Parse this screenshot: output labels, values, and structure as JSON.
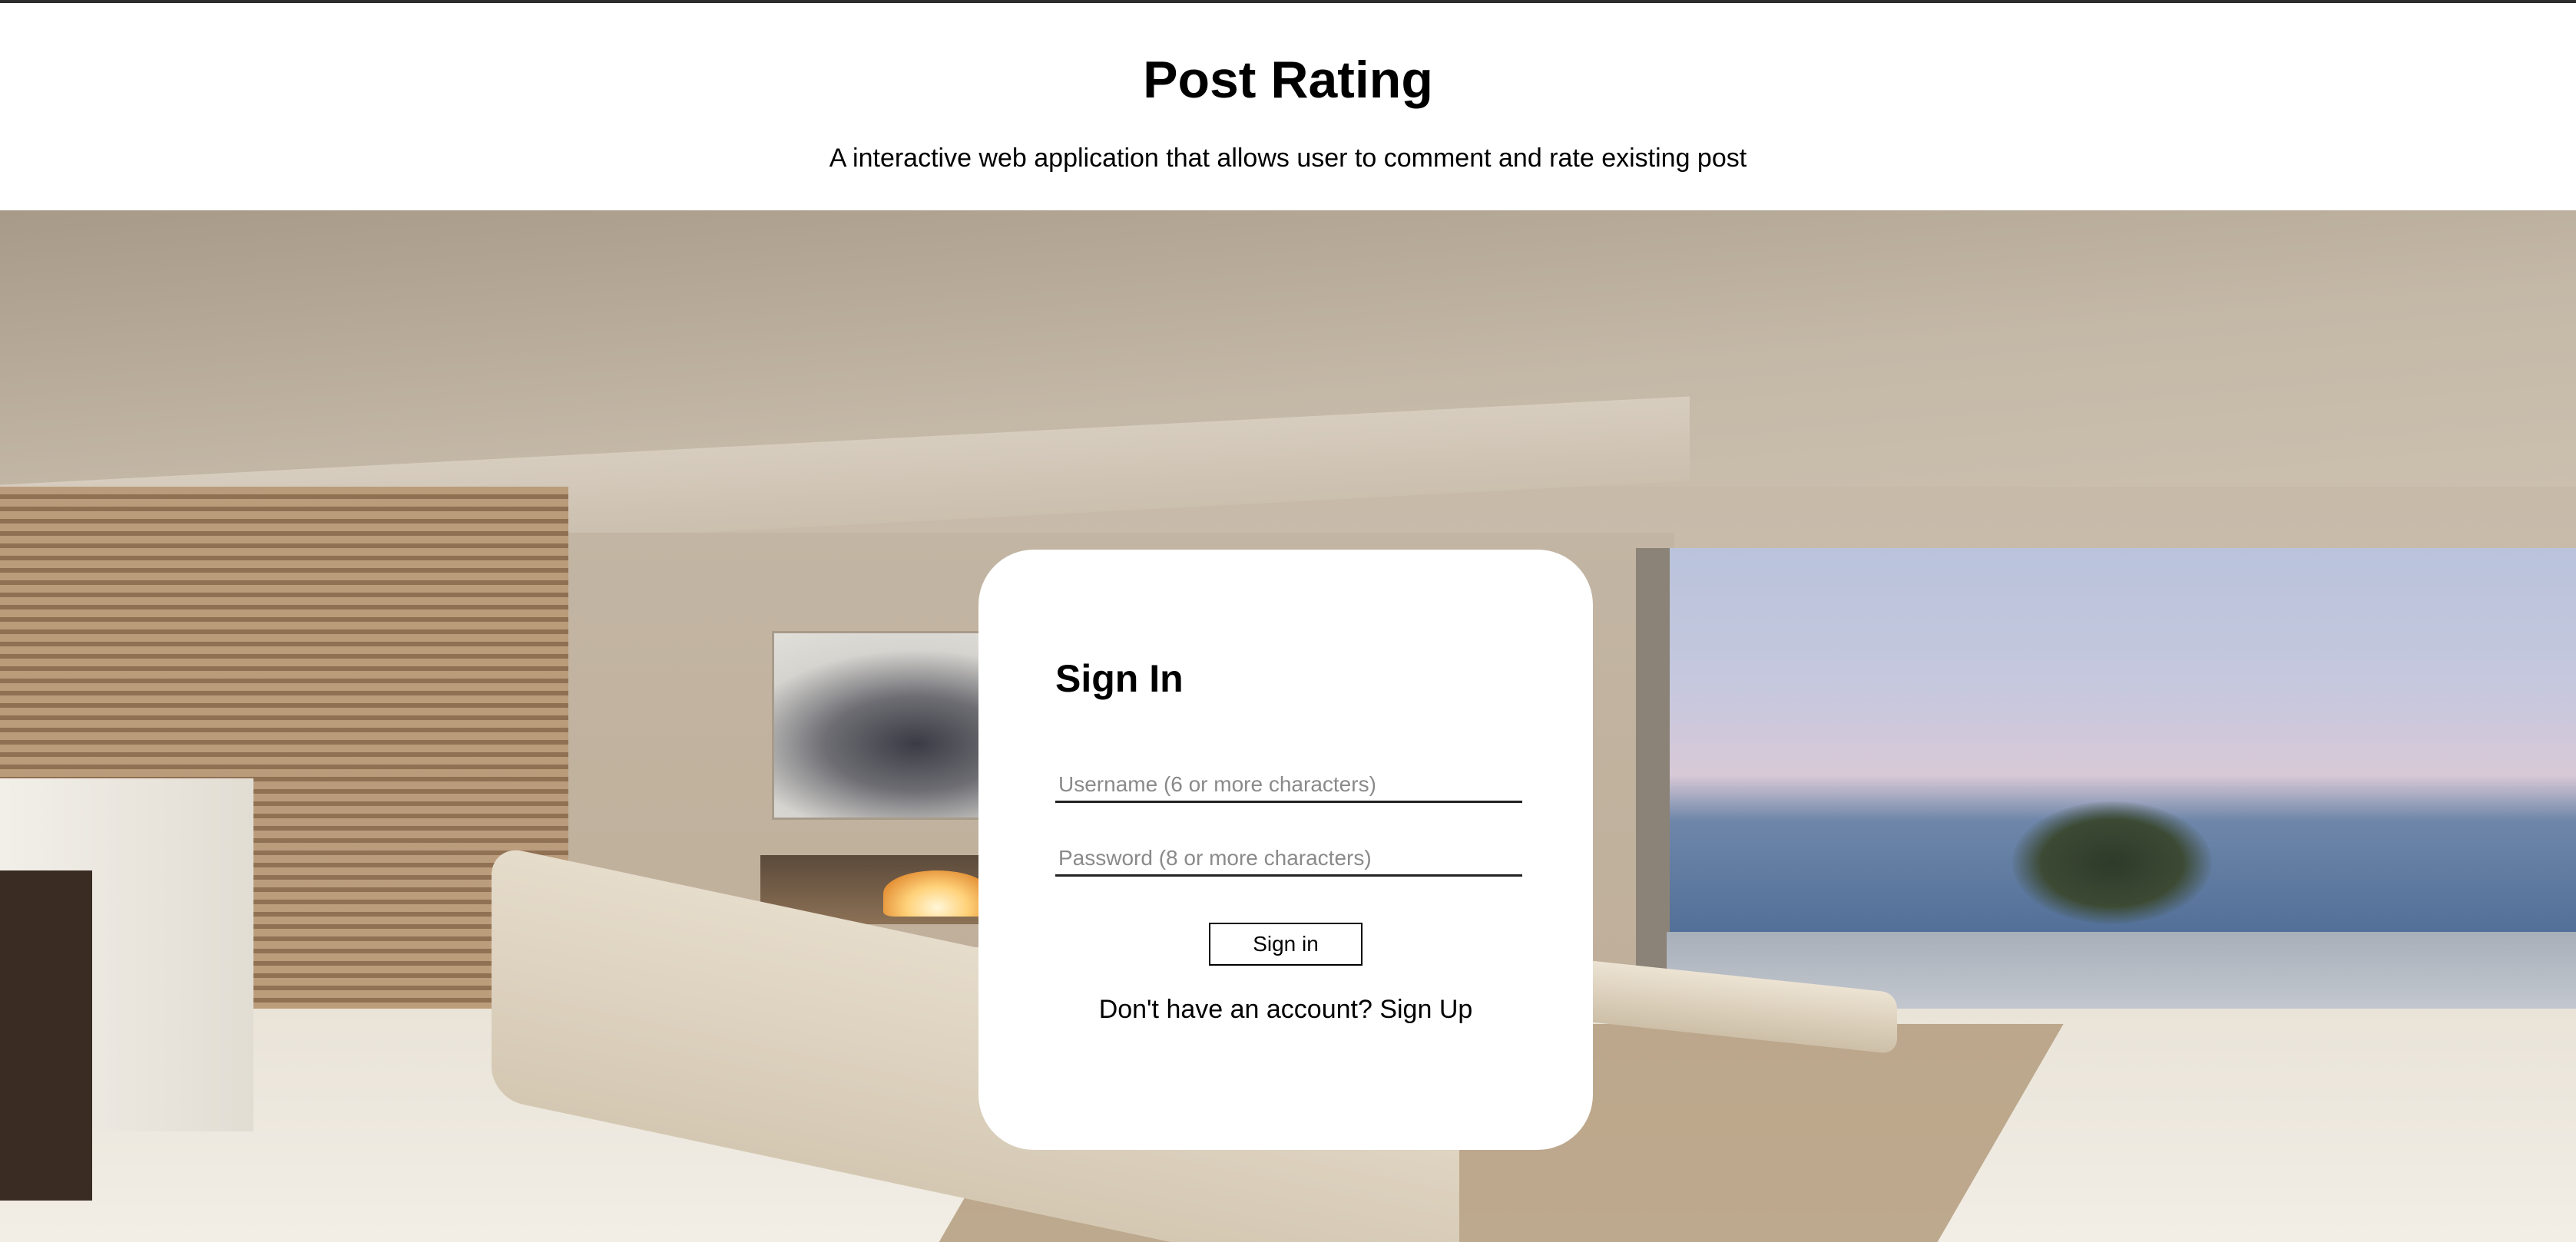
{
  "header": {
    "title": "Post Rating",
    "subtitle": "A interactive web application that allows user to comment and rate existing post"
  },
  "hero": {
    "image": "living-room-ocean-view-photo"
  },
  "signin": {
    "title": "Sign In",
    "username_placeholder": "Username (6 or more characters)",
    "username_value": "",
    "password_placeholder": "Password (8 or more characters)",
    "password_value": "",
    "submit_label": "Sign in",
    "signup_prompt": "Don't have an account?",
    "signup_link": "Sign Up"
  },
  "colors": {
    "header_bg": "#ffffff",
    "top_rule": "#2d2d2d",
    "card_bg": "#ffffff",
    "text": "#000000",
    "placeholder": "#8a8a8a"
  }
}
